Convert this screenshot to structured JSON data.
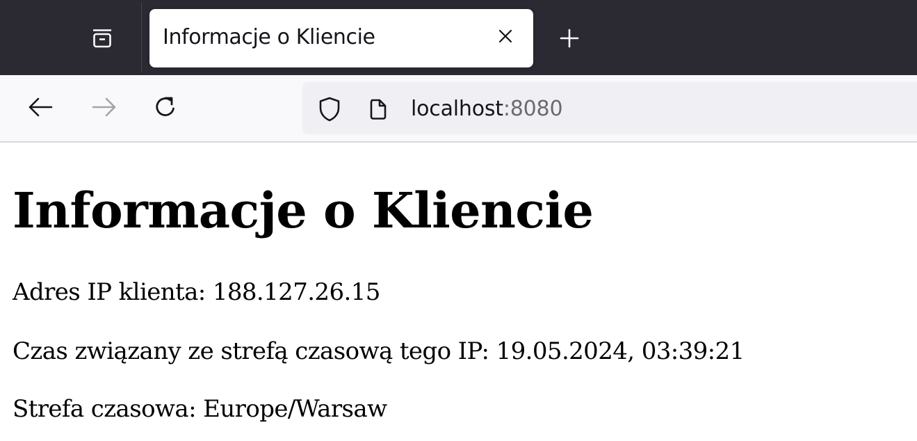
{
  "browser": {
    "tab": {
      "title": "Informacje o Kliencie"
    },
    "address_bar": {
      "host": "localhost",
      "port": ":8080"
    },
    "icons": {
      "tab_list": "tab-list-icon",
      "close_tab": "close-icon",
      "new_tab": "plus-icon",
      "back": "back-arrow-icon",
      "forward": "forward-arrow-icon",
      "reload": "reload-icon",
      "shield": "shield-icon",
      "page": "page-icon"
    }
  },
  "page": {
    "heading": "Informacje o Kliencie",
    "ip_line": "Adres IP klienta: 188.127.26.15",
    "time_line": "Czas związany ze strefą czasową tego IP: 19.05.2024, 03:39:21",
    "timezone_line": "Strefa czasowa: Europe/Warsaw"
  },
  "colors": {
    "tabstrip_bg": "#2b2a33",
    "navbar_bg": "#f9f9fb",
    "urlbar_bg": "#f0f0f4",
    "text": "#000000"
  }
}
